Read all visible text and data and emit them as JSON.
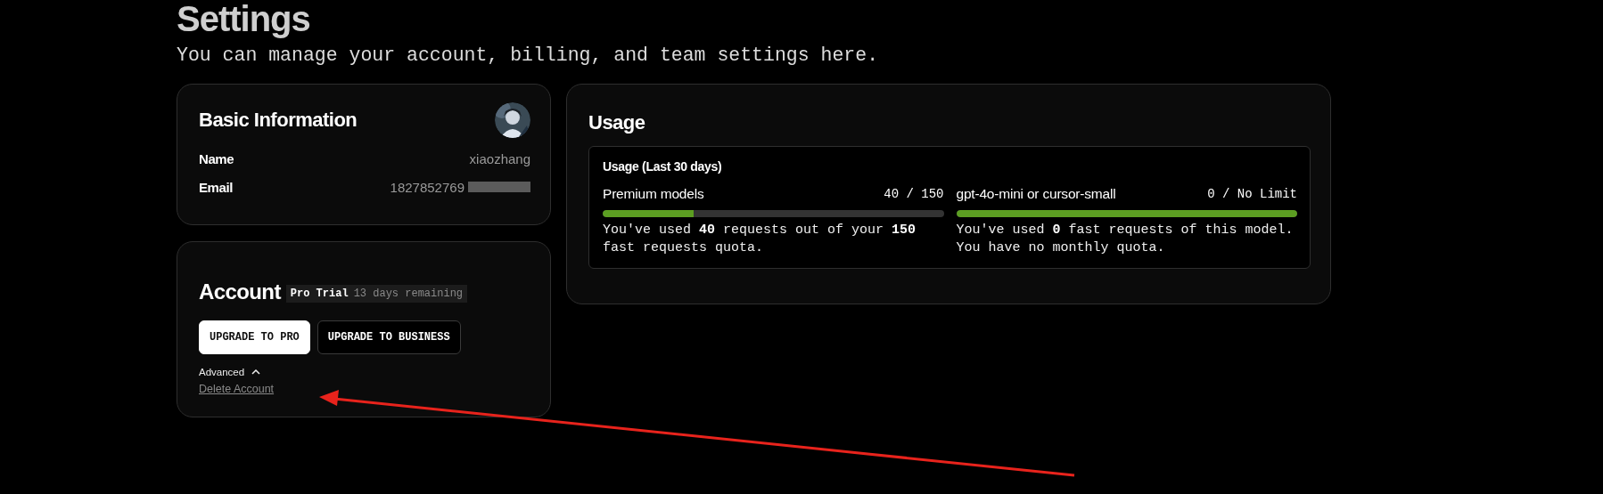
{
  "page": {
    "title": "Settings",
    "subtitle": "You can manage your account, billing, and team settings here."
  },
  "basic_information": {
    "title": "Basic Information",
    "fields": [
      {
        "label": "Name",
        "value": "xiaozhang",
        "redacted": false
      },
      {
        "label": "Email",
        "value": "1827852769",
        "redacted": true
      }
    ]
  },
  "account": {
    "title": "Account",
    "plan_badge": "Pro Trial",
    "plan_note": "13 days remaining",
    "buttons": [
      {
        "label": "UPGRADE TO PRO",
        "kind": "primary"
      },
      {
        "label": "UPGRADE TO BUSINESS",
        "kind": "secondary"
      }
    ],
    "advanced": {
      "label": "Advanced",
      "expanded": true
    },
    "delete_link": "Delete Account"
  },
  "usage": {
    "title": "Usage",
    "panel_title": "Usage (Last 30 days)",
    "meters": [
      {
        "name": "Premium models",
        "reading": "40 / 150",
        "level": 0.267,
        "description": "You've used **40** requests out of your **150** fast requests quota."
      },
      {
        "name": "gpt-4o-mini or cursor-small",
        "reading": "0 / No Limit",
        "level": 1,
        "description": "You've used **0** fast requests of this model. You have no monthly quota."
      }
    ]
  },
  "annotation": {
    "kind": "arrow"
  }
}
